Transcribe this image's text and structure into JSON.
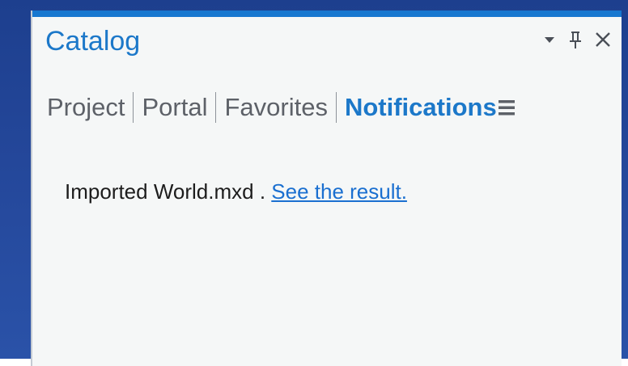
{
  "catalog": {
    "title": "Catalog",
    "controls": {
      "dropdown_icon": "chevron-down-icon",
      "pin_icon": "pin-icon",
      "close_icon": "close-icon"
    },
    "tabs": [
      {
        "label": "Project",
        "active": false
      },
      {
        "label": "Portal",
        "active": false
      },
      {
        "label": "Favorites",
        "active": false
      },
      {
        "label": "Notifications",
        "active": true
      }
    ],
    "menu_icon": "hamburger-menu-icon",
    "notification": {
      "prefix": "Imported ",
      "item": "World.mxd",
      "separator": " . ",
      "link": "See the result."
    }
  },
  "colors": {
    "accent": "#1778d0",
    "active_tab": "#1c78c9",
    "inactive_tab": "#5d6168",
    "link": "#1a6fd0",
    "background": "#24479a"
  }
}
